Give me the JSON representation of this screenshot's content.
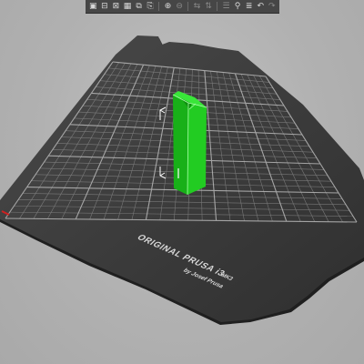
{
  "app": {
    "view": "3d-editor"
  },
  "toolbar": {
    "tools": [
      {
        "name": "add-icon",
        "glyph": "▣"
      },
      {
        "name": "delete-icon",
        "glyph": "⊟"
      },
      {
        "name": "delete-all-icon",
        "glyph": "⊠"
      },
      {
        "name": "arrange-icon",
        "glyph": "▦"
      },
      {
        "name": "copy-icon",
        "glyph": "⧉"
      },
      {
        "name": "paste-icon",
        "glyph": "⎘"
      },
      {
        "name": "add-instance-icon",
        "glyph": "⊕"
      },
      {
        "name": "remove-instance-icon",
        "glyph": "⊖"
      },
      {
        "name": "split-objects-icon",
        "glyph": "⇆"
      },
      {
        "name": "split-parts-icon",
        "glyph": "⇅"
      },
      {
        "name": "variable-layer-height-icon",
        "glyph": "☰"
      },
      {
        "name": "search-icon",
        "glyph": "⚲"
      },
      {
        "name": "layers-icon",
        "glyph": "≣"
      },
      {
        "name": "undo-icon",
        "glyph": "↶"
      },
      {
        "name": "redo-icon",
        "glyph": "↷"
      }
    ]
  },
  "bed": {
    "brand_line": "ORIGINAL PRUSA i3",
    "model": "MK3",
    "byline": "by Josef Prusa"
  },
  "colors": {
    "bed_surface": "#3a3a3a",
    "bed_edge": "#1e1e1e",
    "grid_line": "#8d8d8d",
    "object_green": "#16c516",
    "object_highlight": "#ffffff",
    "origin_marker": "#d02020"
  }
}
